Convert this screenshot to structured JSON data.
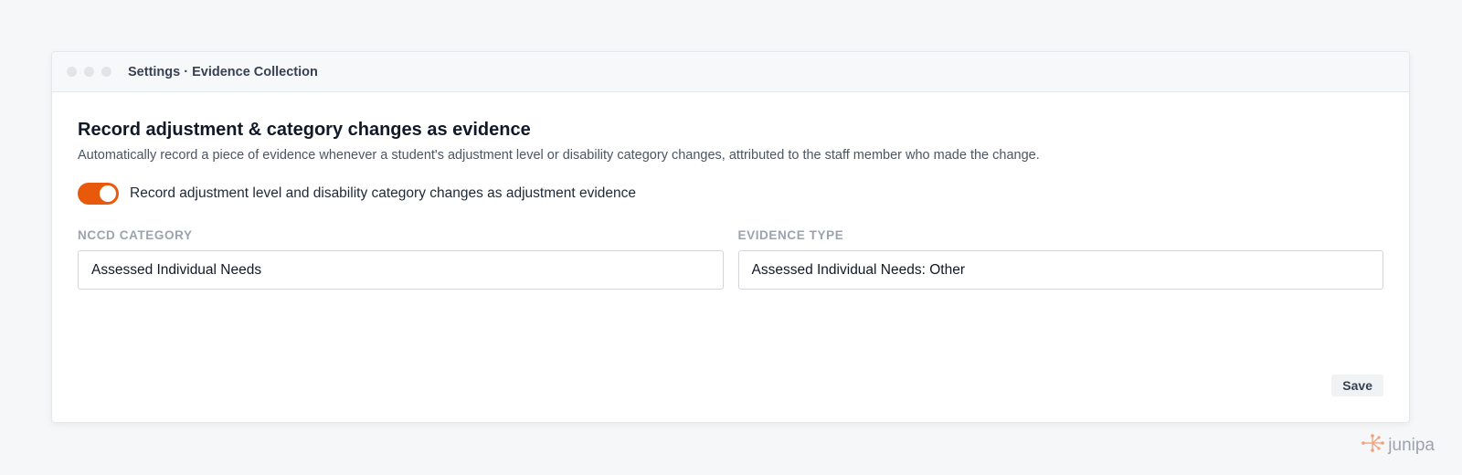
{
  "window": {
    "title": "Settings · Evidence Collection"
  },
  "section": {
    "heading": "Record adjustment & category changes as evidence",
    "description": "Automatically record a piece of evidence whenever a student's adjustment level or disability category changes, attributed to the staff member who made the change."
  },
  "toggle": {
    "label": "Record adjustment level and disability category changes as adjustment evidence",
    "state": "on",
    "color": "#e8590c"
  },
  "fields": {
    "nccd_category": {
      "label": "NCCD CATEGORY",
      "value": "Assessed Individual Needs"
    },
    "evidence_type": {
      "label": "EVIDENCE TYPE",
      "value": "Assessed Individual Needs: Other"
    }
  },
  "actions": {
    "save_label": "Save"
  },
  "brand": {
    "name": "junipa",
    "icon": "junipa-logo-icon",
    "icon_color": "#f0a07a"
  }
}
